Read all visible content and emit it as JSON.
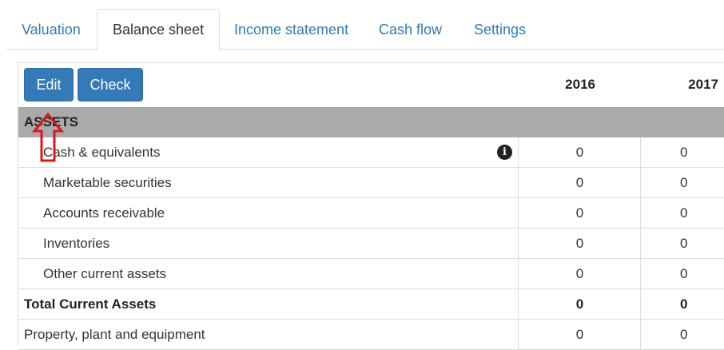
{
  "tabs": [
    {
      "label": "Valuation",
      "active": false
    },
    {
      "label": "Balance sheet",
      "active": true
    },
    {
      "label": "Income statement",
      "active": false
    },
    {
      "label": "Cash flow",
      "active": false
    },
    {
      "label": "Settings",
      "active": false
    }
  ],
  "toolbar": {
    "edit_label": "Edit",
    "check_label": "Check"
  },
  "years": [
    "2016",
    "2017"
  ],
  "section_label": "ASSETS",
  "rows": [
    {
      "label": "Cash & equivalents",
      "v2016": "0",
      "v2017": "0"
    },
    {
      "label": "Marketable securities",
      "v2016": "0",
      "v2017": "0"
    },
    {
      "label": "Accounts receivable",
      "v2016": "0",
      "v2017": "0"
    },
    {
      "label": "Inventories",
      "v2016": "0",
      "v2017": "0"
    },
    {
      "label": "Other current assets",
      "v2016": "0",
      "v2017": "0"
    },
    {
      "label": "Total Current Assets",
      "v2016": "0",
      "v2017": "0"
    },
    {
      "label": "Property, plant and equipment",
      "v2016": "0",
      "v2017": "0"
    }
  ],
  "colors": {
    "accent": "#337ab7",
    "section_bg": "#aaaaaa",
    "annotation": "#e0141e"
  },
  "icons": {
    "info": "info-circle-icon",
    "annotation": "red-arrow-up-icon"
  }
}
